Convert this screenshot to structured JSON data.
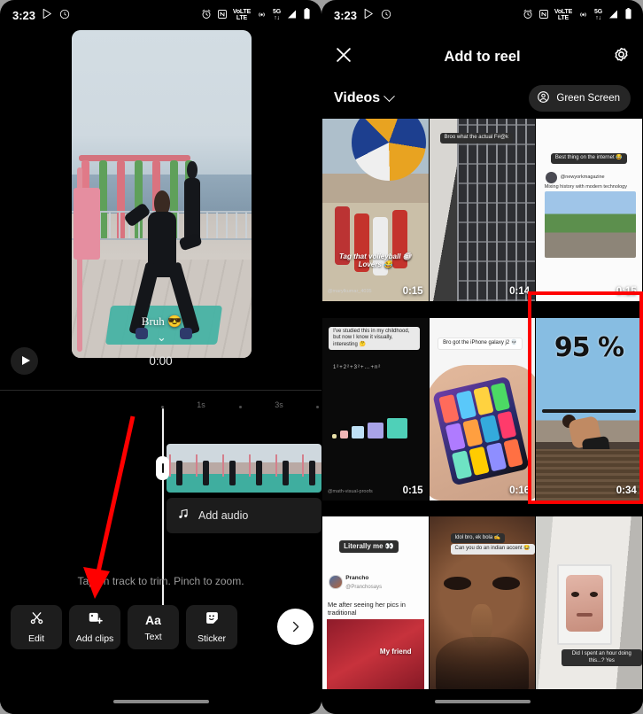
{
  "status_bar": {
    "time": "3:23",
    "left_icons": [
      "play-store-icon",
      "clock-badge-icon"
    ],
    "right_icons": [
      "alarm-icon",
      "nfc-icon",
      "volte-icon",
      "hotspot-icon",
      "5g-icon",
      "signal-icon",
      "battery-icon"
    ],
    "volte_label_top": "VoLTE",
    "volte_label_bottom": "LTE",
    "network_label": "5G"
  },
  "left_panel": {
    "preview": {
      "caption": "Bruh 😎",
      "chevron": "⌄"
    },
    "playback": {
      "play_icon": "play-icon",
      "current_time": "0:00"
    },
    "timeline": {
      "ruler_labels": [
        "1s",
        "3s"
      ],
      "audio_track_label": "Add audio",
      "audio_icon": "music-note-icon",
      "hint": "Tap on track to trim. Pinch to zoom."
    },
    "toolbar": [
      {
        "label": "Edit",
        "icon": "scissors-icon"
      },
      {
        "label": "Add clips",
        "icon": "add-image-icon"
      },
      {
        "label": "Text",
        "icon": "text-aa-icon"
      },
      {
        "label": "Sticker",
        "icon": "sticker-icon"
      }
    ],
    "next_button": {
      "icon": "chevron-right-icon"
    }
  },
  "right_panel": {
    "header": {
      "close_icon": "close-x-icon",
      "title": "Add to reel",
      "settings_icon": "gear-icon"
    },
    "subbar": {
      "selector_label": "Videos",
      "selector_icon": "chevron-down-icon",
      "green_screen_label": "Green Screen",
      "green_screen_icon": "person-circle-icon"
    },
    "grid": [
      {
        "kind": "volleyball",
        "duration": "0:15",
        "caption_line1": "Tag that volleyball 🏐",
        "caption_line2": "Lovers 😂",
        "handle": "@marylkumar_4035",
        "highlighted": false
      },
      {
        "kind": "building-grill",
        "duration": "0:14",
        "overlay_text": "Broo what the actual F#@k",
        "highlighted": false
      },
      {
        "kind": "robot-dog",
        "duration": "0:15",
        "overlay_text": "Best thing on the internet 😂",
        "account": "@newyorkmagazine",
        "sub_text": "Mixing history with modern technology",
        "highlighted": false
      },
      {
        "kind": "math-visual",
        "duration": "0:15",
        "overlay_text": "I've studied this in my childhood, but now I know it visually, interesting 🤔",
        "handle": "@math-visual-proofs",
        "highlighted": false
      },
      {
        "kind": "iphone-hand",
        "duration": "0:16",
        "overlay_text": "Bro got the iPhone galaxy j2 💀",
        "highlighted": false
      },
      {
        "kind": "pullup-95",
        "duration": "0:34",
        "overlay_text": "95 %",
        "highlighted": true
      },
      {
        "kind": "literally-me",
        "duration": "",
        "overlay_text": "Literally me 👀",
        "account": "Prancho",
        "handle": "@Pranchosays",
        "sub_text": "Me after seeing her pics in traditional",
        "image_caption": "My friend",
        "highlighted": false
      },
      {
        "kind": "face-closeup",
        "duration": "",
        "overlay_text": "Idol bro, ek bola ✍",
        "overlay_text2": "Can you do an indian accent 😂",
        "highlighted": false
      },
      {
        "kind": "mirror-face",
        "duration": "",
        "overlay_text": "Did I spent an hour doing this...? Yes",
        "highlighted": false
      }
    ]
  },
  "annotations": {
    "arrow_color": "#ff0000",
    "highlight_color": "#ff0000",
    "arrow_target": "add-clips-button",
    "highlight_target": "grid-cell-pullup-95"
  },
  "nav_bar": {
    "pill": "home-indicator"
  }
}
